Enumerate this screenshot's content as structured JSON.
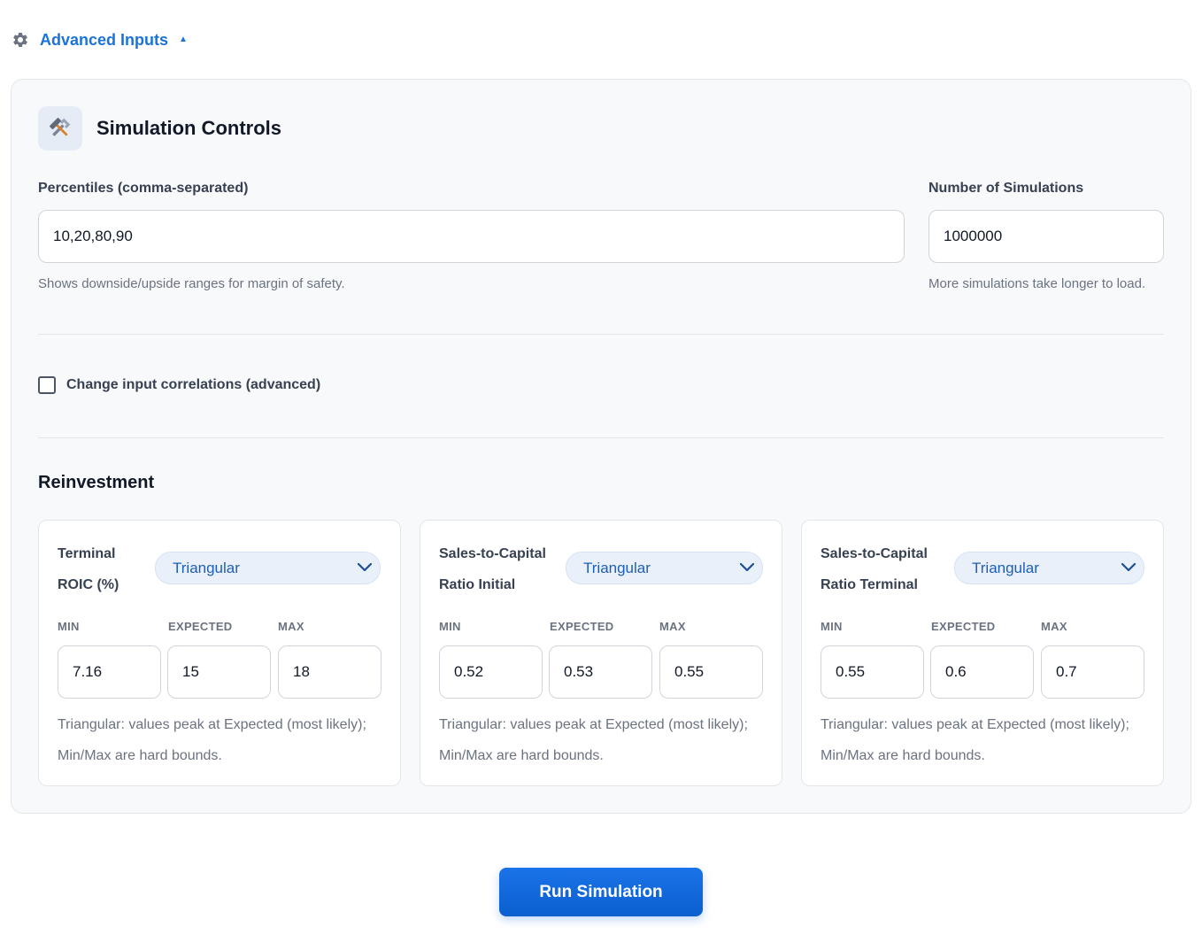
{
  "advanced_toggle": {
    "label": "Advanced Inputs",
    "caret": "▲",
    "icon": "gear-icon",
    "color": "#1a73d9"
  },
  "panel": {
    "title": "Simulation Controls",
    "icon": "tools-icon",
    "percentiles": {
      "label": "Percentiles (comma-separated)",
      "value": "10,20,80,90",
      "helper": "Shows downside/upside ranges for margin of safety."
    },
    "simulations": {
      "label": "Number of Simulations",
      "value": "1000000",
      "helper": "More simulations take longer to load."
    },
    "correlations": {
      "label": "Change input correlations (advanced)",
      "checked": false
    }
  },
  "reinvestment": {
    "title": "Reinvestment",
    "cards": [
      {
        "label_line1": "Terminal",
        "label_line2": "ROIC (%)",
        "distribution": "Triangular",
        "min_label": "MIN",
        "expected_label": "EXPECTED",
        "max_label": "MAX",
        "min": "7.16",
        "expected": "15",
        "max": "18",
        "note": "Triangular: values peak at Expected (most likely); Min/Max are hard bounds."
      },
      {
        "label_line1": "Sales-to-Capital",
        "label_line2": "Ratio Initial",
        "distribution": "Triangular",
        "min_label": "MIN",
        "expected_label": "EXPECTED",
        "max_label": "MAX",
        "min": "0.52",
        "expected": "0.53",
        "max": "0.55",
        "note": "Triangular: values peak at Expected (most likely); Min/Max are hard bounds."
      },
      {
        "label_line1": "Sales-to-Capital",
        "label_line2": "Ratio Terminal",
        "distribution": "Triangular",
        "min_label": "MIN",
        "expected_label": "EXPECTED",
        "max_label": "MAX",
        "min": "0.55",
        "expected": "0.6",
        "max": "0.7",
        "note": "Triangular: values peak at Expected (most likely); Min/Max are hard bounds."
      }
    ]
  },
  "run_button": {
    "label": "Run Simulation",
    "color": "#1a73e8"
  }
}
